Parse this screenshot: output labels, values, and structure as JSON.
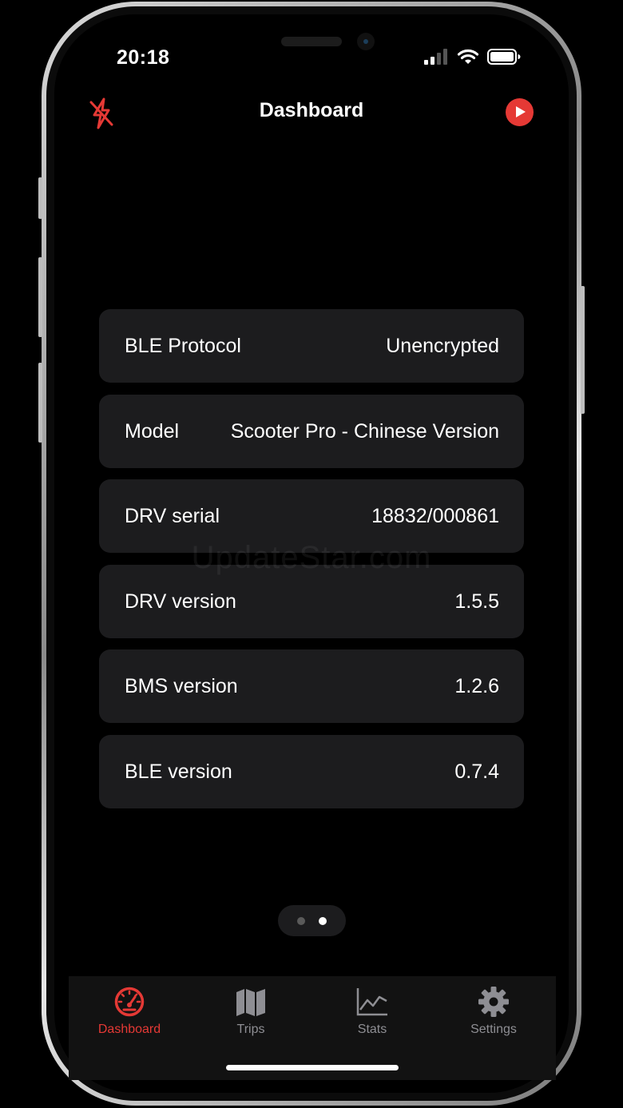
{
  "status_bar": {
    "time": "20:18"
  },
  "nav": {
    "title": "Dashboard",
    "left_icon": "bluetooth-off-icon",
    "right_icon": "play-icon",
    "accent_color": "#e53935"
  },
  "info_rows": [
    {
      "label": "BLE Protocol",
      "value": "Unencrypted"
    },
    {
      "label": "Model",
      "value": "Scooter Pro - Chinese Version"
    },
    {
      "label": "DRV serial",
      "value": "18832/000861"
    },
    {
      "label": "DRV version",
      "value": "1.5.5"
    },
    {
      "label": "BMS version",
      "value": "1.2.6"
    },
    {
      "label": "BLE version",
      "value": "0.7.4"
    }
  ],
  "watermark": "UpdateStar.com",
  "pager": {
    "page_count": 2,
    "current_page": 2
  },
  "tabs": [
    {
      "label": "Dashboard",
      "icon": "speedometer-icon",
      "active": true
    },
    {
      "label": "Trips",
      "icon": "map-icon",
      "active": false
    },
    {
      "label": "Stats",
      "icon": "chart-icon",
      "active": false
    },
    {
      "label": "Settings",
      "icon": "gear-icon",
      "active": false
    }
  ]
}
